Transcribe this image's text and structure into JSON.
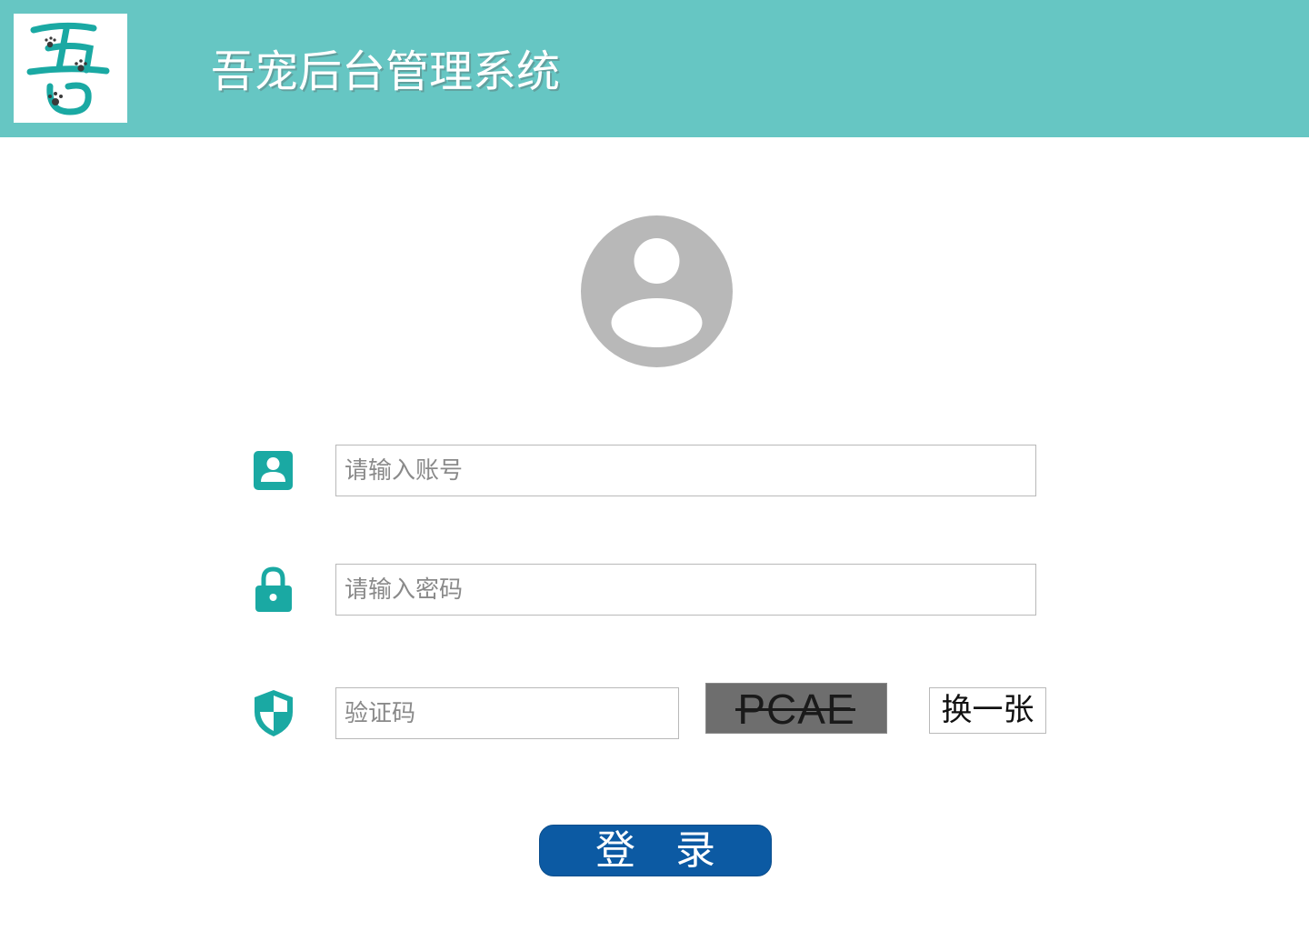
{
  "header": {
    "logo_text": "吾",
    "title": "吾宠后台管理系统"
  },
  "colors": {
    "header_bg": "#66c6c3",
    "accent_teal": "#1aa9a3",
    "avatar_gray": "#b8b8b8",
    "login_button_bg": "#0c5aa3",
    "captcha_bg": "#6e6e6e"
  },
  "form": {
    "account": {
      "icon": "user-card-icon",
      "placeholder": "请输入账号",
      "value": ""
    },
    "password": {
      "icon": "lock-icon",
      "placeholder": "请输入密码",
      "value": ""
    },
    "captcha": {
      "icon": "shield-icon",
      "placeholder": "验证码",
      "value": "",
      "image_text": "PCAE",
      "refresh_label": "换一张"
    },
    "login_label": "登录"
  },
  "avatar_icon": "user-avatar-icon"
}
